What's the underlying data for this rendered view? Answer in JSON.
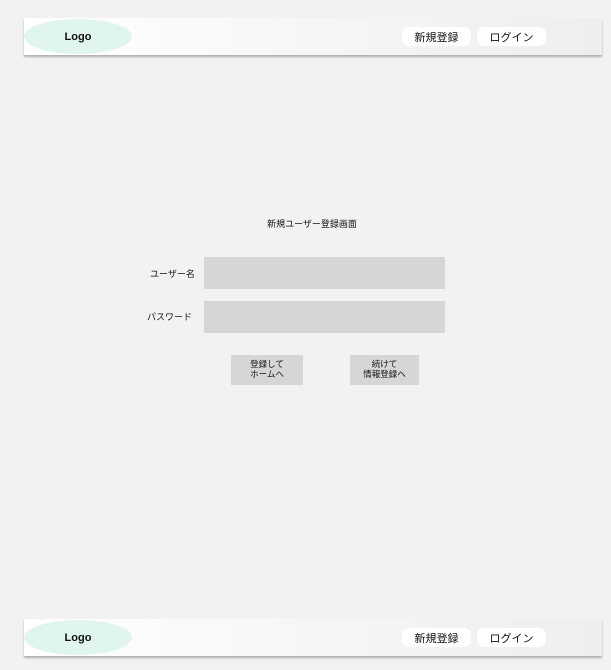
{
  "header": {
    "logo": "Logo",
    "register_label": "新規登録",
    "login_label": "ログイン"
  },
  "form": {
    "title": "新規ユーザー登録画面",
    "username_label": "ユーザー名",
    "username_value": "",
    "password_label": "パスワード",
    "password_value": "",
    "buttons": {
      "home_line1": "登録して",
      "home_line2": "ホームへ",
      "continue_line1": "続けて",
      "continue_line2": "情報登録へ"
    }
  },
  "footer": {
    "logo": "Logo",
    "register_label": "新規登録",
    "login_label": "ログイン"
  },
  "colors": {
    "background": "#f2f2f2",
    "logo_bg": "#dff5ee",
    "field_bg": "#d6d6d6"
  }
}
